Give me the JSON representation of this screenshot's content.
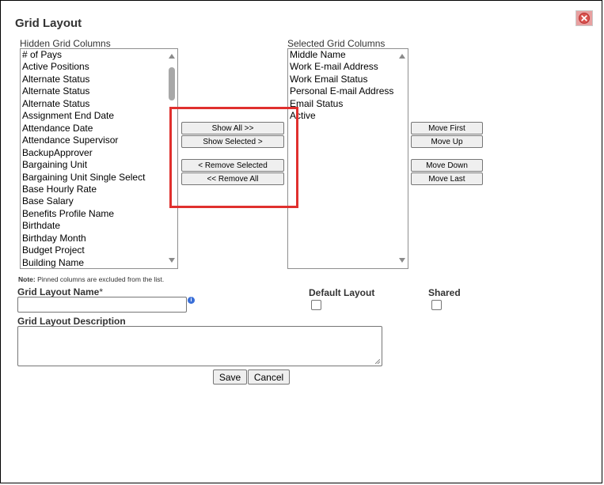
{
  "dialog": {
    "title": "Grid Layout"
  },
  "hidden_columns": {
    "label": "Hidden Grid Columns",
    "items": [
      "# of Pays",
      "Active Positions",
      "Alternate Status",
      "Alternate Status",
      "Alternate Status",
      "Assignment End Date",
      "Attendance Date",
      "Attendance Supervisor",
      "BackupApprover",
      "Bargaining Unit",
      "Bargaining Unit Single Select",
      "Base Hourly Rate",
      "Base Salary",
      "Benefits Profile Name",
      "Birthdate",
      "Birthday Month",
      "Budget Project",
      "Building Name"
    ]
  },
  "selected_columns": {
    "label": "Selected Grid Columns",
    "items": [
      "Middle Name",
      "Work E-mail Address",
      "Work Email Status",
      "Personal E-mail Address",
      "Email Status",
      "Active"
    ]
  },
  "transfer_buttons": {
    "show_all": "Show All >>",
    "show_selected": "Show Selected >",
    "remove_selected": "< Remove Selected",
    "remove_all": "<< Remove All"
  },
  "order_buttons": {
    "move_first": "Move First",
    "move_up": "Move Up",
    "move_down": "Move Down",
    "move_last": "Move Last"
  },
  "note": {
    "prefix": "Note:",
    "text": " Pinned columns are excluded from the list."
  },
  "form": {
    "name_label": "Grid Layout Name",
    "required_mark": "*",
    "name_value": "",
    "default_label": "Default Layout",
    "default_checked": false,
    "shared_label": "Shared",
    "shared_checked": false,
    "description_label": "Grid Layout Description",
    "description_value": "",
    "info_glyph": "i"
  },
  "actions": {
    "save": "Save",
    "cancel": "Cancel"
  },
  "colors": {
    "highlight": "#e0302e",
    "close_bg": "#e8a0a0",
    "info": "#3a6fd8"
  },
  "icons": {
    "close": "close-icon",
    "info": "info-icon",
    "scroll_up": "scroll-up-arrow-icon",
    "scroll_down": "scroll-down-arrow-icon"
  }
}
